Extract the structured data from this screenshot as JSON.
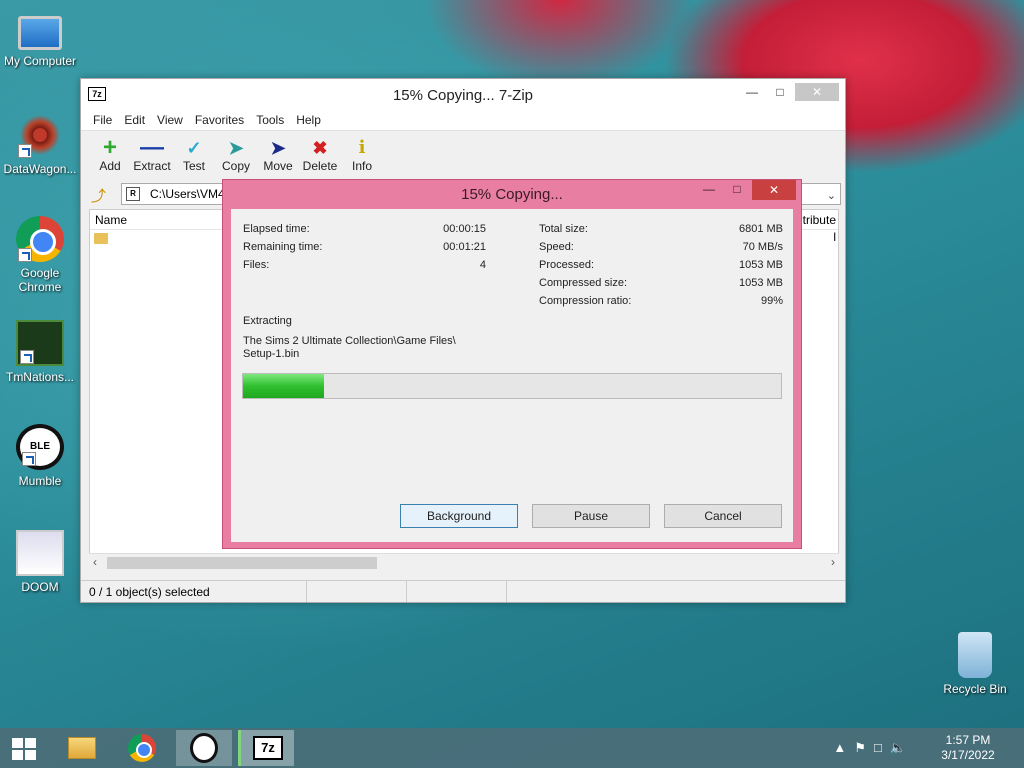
{
  "desktop": {
    "icons": [
      {
        "label": "My Computer"
      },
      {
        "label": "DataWagon..."
      },
      {
        "label": "Google Chrome"
      },
      {
        "label": "TmNations..."
      },
      {
        "label": "Mumble"
      },
      {
        "label": "DOOM"
      },
      {
        "label": "Recycle Bin"
      }
    ]
  },
  "zip_window": {
    "title": "15% Copying... 7-Zip",
    "app_icon_text": "7z",
    "menu": [
      "File",
      "Edit",
      "View",
      "Favorites",
      "Tools",
      "Help"
    ],
    "toolbar": [
      {
        "label": "Add",
        "icon": "plus-icon",
        "color": "#2eaa2e"
      },
      {
        "label": "Extract",
        "icon": "minus-icon",
        "color": "#1a3fa8"
      },
      {
        "label": "Test",
        "icon": "check-icon",
        "color": "#2aaacc"
      },
      {
        "label": "Copy",
        "icon": "copy-arrow-icon",
        "color": "#2a9a9a"
      },
      {
        "label": "Move",
        "icon": "move-arrow-icon",
        "color": "#1a2a8a"
      },
      {
        "label": "Delete",
        "icon": "x-icon",
        "color": "#d42020"
      },
      {
        "label": "Info",
        "icon": "info-icon",
        "color": "#c8a800"
      }
    ],
    "address": "C:\\Users\\VM4\\",
    "address_icon_text": "R",
    "columns": {
      "name": "Name",
      "attributes": "tribute"
    },
    "row_fragment": "l",
    "status": "0 / 1 object(s) selected"
  },
  "progress_dialog": {
    "title": "15% Copying...",
    "left_stats": [
      {
        "label": "Elapsed time:",
        "value": "00:00:15"
      },
      {
        "label": "Remaining time:",
        "value": "00:01:21"
      },
      {
        "label": "Files:",
        "value": "4"
      }
    ],
    "right_stats": [
      {
        "label": "Total size:",
        "value": "6801 MB"
      },
      {
        "label": "Speed:",
        "value": "70 MB/s"
      },
      {
        "label": "Processed:",
        "value": "1053 MB"
      },
      {
        "label": "Compressed size:",
        "value": "1053 MB"
      },
      {
        "label": "Compression ratio:",
        "value": "99%"
      }
    ],
    "operation": "Extracting",
    "path_line1": "The Sims 2 Ultimate Collection\\Game Files\\",
    "path_line2": "Setup-1.bin",
    "progress_fraction": 0.15,
    "buttons": {
      "background": "Background",
      "pause": "Pause",
      "cancel": "Cancel"
    }
  },
  "taskbar": {
    "zip_icon_text": "7z",
    "time": "1:57 PM",
    "date": "3/17/2022"
  }
}
